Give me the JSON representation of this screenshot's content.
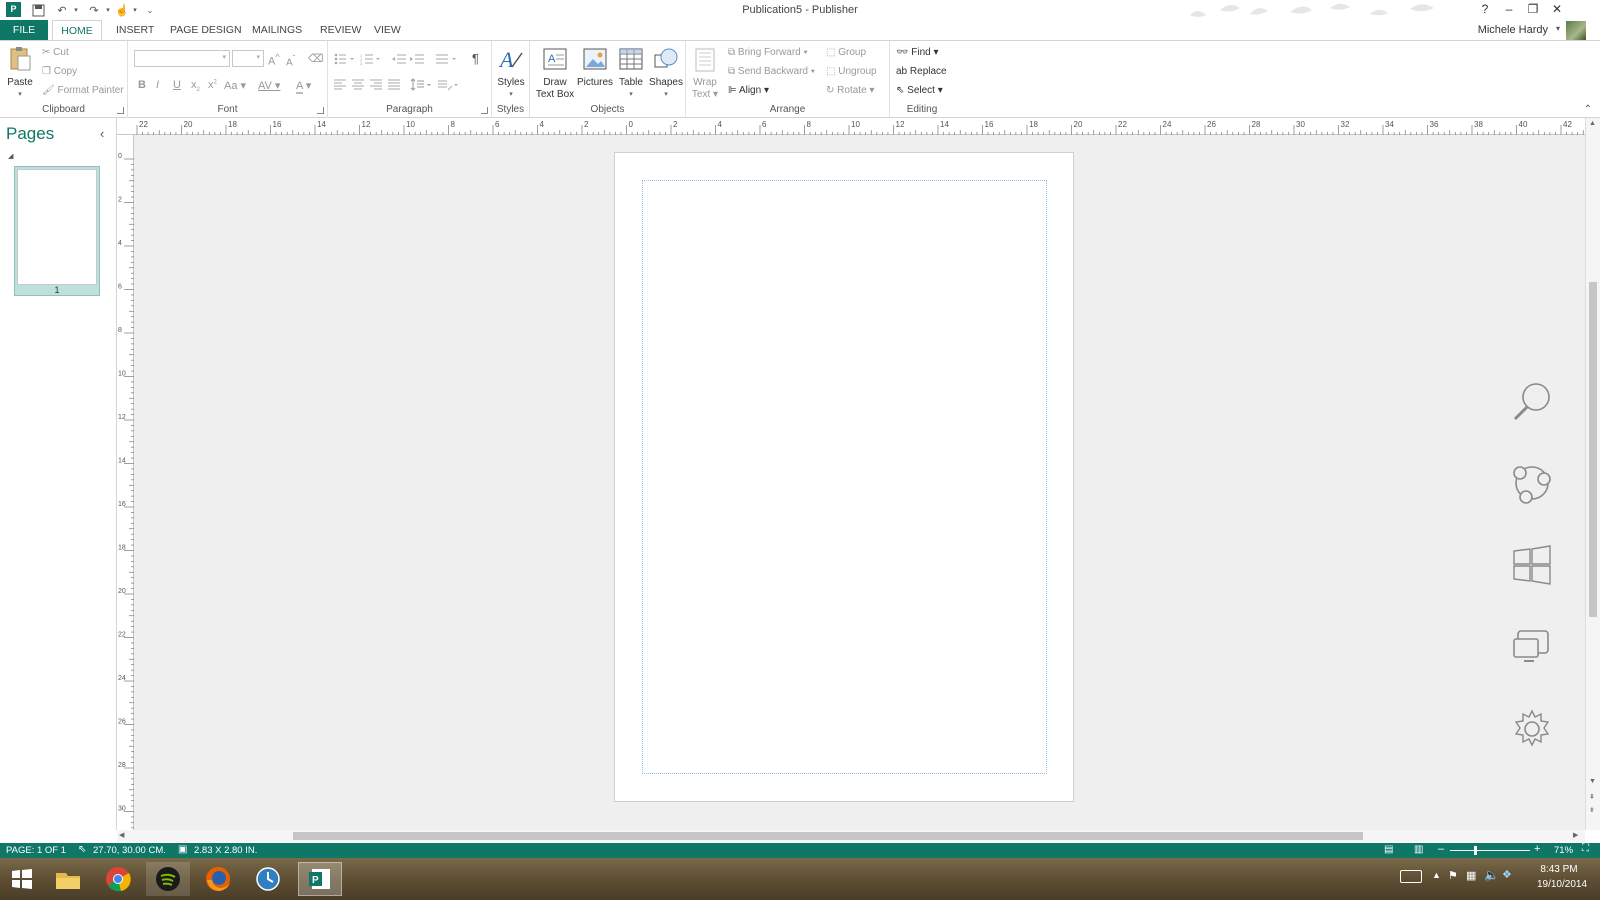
{
  "window": {
    "title": "Publication5 - Publisher",
    "help": "?",
    "minimize": "–",
    "restore": "❐",
    "close": "✕"
  },
  "tabs": [
    "FILE",
    "HOME",
    "INSERT",
    "PAGE DESIGN",
    "MAILINGS",
    "REVIEW",
    "VIEW"
  ],
  "active_tab": "HOME",
  "user": {
    "name": "Michele Hardy"
  },
  "ribbon": {
    "clipboard": {
      "label": "Clipboard",
      "paste": "Paste",
      "cut": "Cut",
      "copy": "Copy",
      "format_painter": "Format Painter"
    },
    "font": {
      "label": "Font",
      "font_name": "",
      "font_size": "",
      "grow": "A",
      "shrink": "A",
      "bold": "B",
      "italic": "I",
      "underline": "U",
      "subscript": "x",
      "superscript": "x",
      "change_case": "Aa",
      "spacing": "AV",
      "font_color": "A"
    },
    "paragraph": {
      "label": "Paragraph",
      "pilcrow": "¶"
    },
    "styles": {
      "label": "Styles",
      "button": "Styles"
    },
    "objects": {
      "label": "Objects",
      "draw_text_box_1": "Draw",
      "draw_text_box_2": "Text Box",
      "pictures": "Pictures",
      "table": "Table",
      "shapes": "Shapes"
    },
    "arrange": {
      "label": "Arrange",
      "wrap_text_1": "Wrap",
      "wrap_text_2": "Text",
      "bring_forward": "Bring Forward",
      "send_backward": "Send Backward",
      "align": "Align",
      "group": "Group",
      "ungroup": "Ungroup",
      "rotate": "Rotate"
    },
    "editing": {
      "label": "Editing",
      "find": "Find",
      "replace": "Replace",
      "select": "Select"
    }
  },
  "pages_pane": {
    "title": "Pages",
    "collapse": "‹",
    "thumbs": [
      {
        "number": "1"
      }
    ]
  },
  "hruler": {
    "labels": [
      "22",
      "20",
      "18",
      "16",
      "14",
      "12",
      "10",
      "8",
      "6",
      "4",
      "2",
      "0",
      "2",
      "4",
      "6",
      "8",
      "10",
      "12",
      "14",
      "16",
      "18",
      "20",
      "22",
      "24",
      "26",
      "28",
      "30",
      "32",
      "34",
      "36",
      "38",
      "40",
      "42"
    ]
  },
  "vruler": {
    "labels": [
      "0",
      "2",
      "4",
      "6",
      "8",
      "10",
      "12",
      "14",
      "16",
      "18",
      "20",
      "22",
      "24",
      "26",
      "28",
      "30"
    ]
  },
  "status": {
    "page": "PAGE: 1 OF 1",
    "position": "27.70, 30.00 CM.",
    "size": "2.83 X 2.80 IN.",
    "zoom": "71%"
  },
  "taskbar": {
    "apps": [
      "start-icon",
      "file-explorer-icon",
      "chrome-icon",
      "spotify-icon",
      "firefox-icon",
      "time-machine-icon",
      "publisher-icon"
    ],
    "time": "8:43 PM",
    "date": "19/10/2014"
  },
  "charms": [
    "search-icon",
    "share-icon",
    "start-icon",
    "devices-icon",
    "settings-icon"
  ],
  "colors": {
    "accent": "#0e7766",
    "workspace": "#efefef",
    "page_guide": "#9ec9e8"
  }
}
